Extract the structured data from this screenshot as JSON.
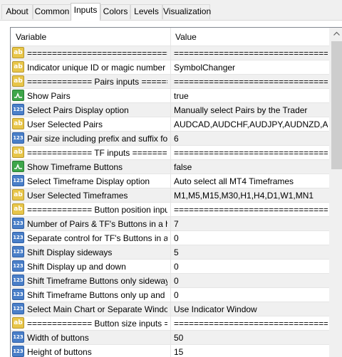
{
  "tabs": [
    {
      "label": "About",
      "active": false
    },
    {
      "label": "Common",
      "active": false
    },
    {
      "label": "Inputs",
      "active": true
    },
    {
      "label": "Colors",
      "active": false
    },
    {
      "label": "Levels",
      "active": false
    },
    {
      "label": "Visualization",
      "active": false
    }
  ],
  "grid": {
    "header": {
      "variable": "Variable",
      "value": "Value"
    },
    "rows": [
      {
        "icon": "string-icon",
        "name": "==============================",
        "value": "================================"
      },
      {
        "icon": "string-icon",
        "name": "Indicator unique ID or magic number",
        "value": "SymbolChanger"
      },
      {
        "icon": "string-icon",
        "name": "============= Pairs inputs ===================",
        "value": "================================"
      },
      {
        "icon": "bool-icon",
        "name": "Show Pairs",
        "value": "true"
      },
      {
        "icon": "number-icon",
        "name": "Select Pairs Display option",
        "value": "Manually select Pairs by the Trader"
      },
      {
        "icon": "string-icon",
        "name": "User Selected Pairs",
        "value": "AUDCAD,AUDCHF,AUDJPY,AUDNZD,AUDUSD"
      },
      {
        "icon": "number-icon",
        "name": "Pair size including prefix and suffix for Meta",
        "value": "6"
      },
      {
        "icon": "string-icon",
        "name": "============= TF inputs ===================",
        "value": "================================"
      },
      {
        "icon": "bool-icon",
        "name": "Show Timeframe Buttons",
        "value": "false"
      },
      {
        "icon": "number-icon",
        "name": "Select Timeframe Display option",
        "value": "Auto select all MT4 Timeframes"
      },
      {
        "icon": "string-icon",
        "name": "User Selected Timeframes",
        "value": "M1,M5,M15,M30,H1,H4,D1,W1,MN1"
      },
      {
        "icon": "string-icon",
        "name": "============= Button position inputs =========",
        "value": "================================"
      },
      {
        "icon": "number-icon",
        "name": "Number of Pairs & TF's Buttons in a horizontal",
        "value": "7"
      },
      {
        "icon": "number-icon",
        "name": "Separate control for TF's Buttons in a horiz",
        "value": "0"
      },
      {
        "icon": "number-icon",
        "name": "Shift Display sideways",
        "value": "5"
      },
      {
        "icon": "number-icon",
        "name": "Shift Display up and down",
        "value": "0"
      },
      {
        "icon": "number-icon",
        "name": "Shift Timeframe Buttons only sideways",
        "value": "0"
      },
      {
        "icon": "number-icon",
        "name": "Shift Timeframe Buttons only up and down",
        "value": "0"
      },
      {
        "icon": "number-icon",
        "name": "Select Main Chart or Separate Window",
        "value": "Use Indicator Window"
      },
      {
        "icon": "string-icon",
        "name": "============= Button size inputs ============",
        "value": "================================"
      },
      {
        "icon": "number-icon",
        "name": "Width of buttons",
        "value": "50"
      },
      {
        "icon": "number-icon",
        "name": "Height of buttons",
        "value": "15"
      }
    ]
  },
  "icon_labels": {
    "string": "ab",
    "number": "123"
  },
  "colors": {
    "selected_tab_bg": "#ffffff",
    "alt_row_bg": "#f0f0f0",
    "grid_line": "#e5e5e5",
    "string_icon": "#e8c64a",
    "number_icon": "#4a7fc8",
    "bool_icon": "#3ea64a"
  }
}
